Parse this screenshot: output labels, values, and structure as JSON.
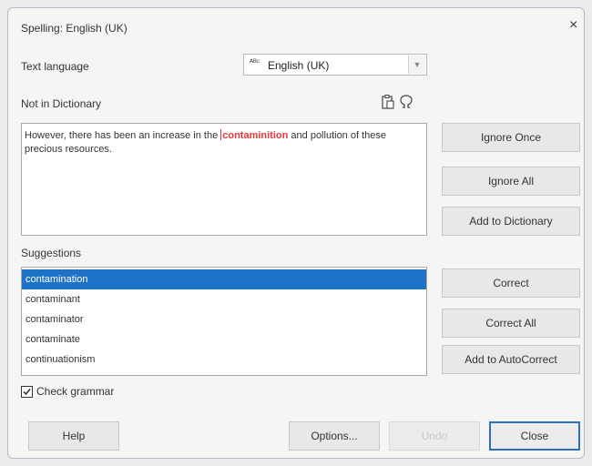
{
  "dialog": {
    "title": "Spelling: English (UK)",
    "close_label": "×"
  },
  "language": {
    "label": "Text language",
    "value": "English (UK)",
    "abc": "ᴬᴮᶜ",
    "arrow": "▼"
  },
  "not_in_dictionary": {
    "label": "Not in Dictionary",
    "text_before": "However, there has been an increase in the ",
    "error_word": "contaminition",
    "text_after": " and pollution of these precious resources."
  },
  "side_buttons": {
    "ignore_once": "Ignore Once",
    "ignore_all": "Ignore All",
    "add_to_dictionary": "Add to Dictionary",
    "correct": "Correct",
    "correct_all": "Correct All",
    "add_to_autocorrect": "Add to AutoCorrect"
  },
  "suggestions": {
    "label": "Suggestions",
    "items": [
      "contamination",
      "contaminant",
      "contaminator",
      "contaminate",
      "continuationism"
    ],
    "selected_index": 0
  },
  "check_grammar": {
    "label": "Check grammar",
    "checked": true
  },
  "footer": {
    "help": "Help",
    "options": "Options...",
    "undo": "Undo",
    "close": "Close"
  },
  "colors": {
    "selection": "#1f73c7",
    "error": "#e5393b",
    "default_border": "#2c6fc2"
  }
}
